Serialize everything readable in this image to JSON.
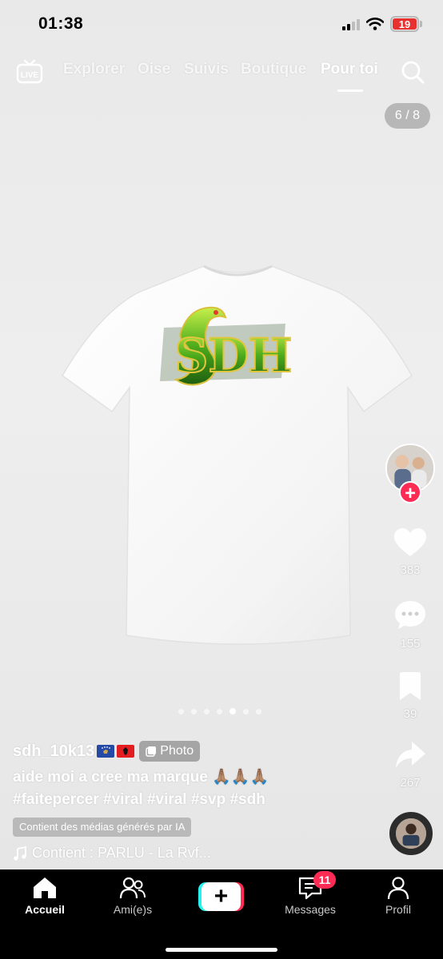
{
  "status_bar": {
    "time": "01:38",
    "battery": "19"
  },
  "top_nav": {
    "live_label": "LIVE",
    "tabs": [
      {
        "label": "Explorer",
        "active": false
      },
      {
        "label": "Oise",
        "active": false
      },
      {
        "label": "Suivis",
        "active": false
      },
      {
        "label": "Boutique",
        "active": false
      },
      {
        "label": "Pour toi",
        "active": true
      }
    ]
  },
  "post": {
    "page_counter": "6 / 8",
    "logo_text": "SDH",
    "carousel": {
      "total": 7,
      "active_index": 4
    },
    "username": "sdh_10k13",
    "flags": [
      "kosovo-flag",
      "albania-flag"
    ],
    "photo_badge": "Photo",
    "description": "aide moi a cree ma marque 🙏🏽🙏🏽🙏🏽",
    "hashtags": "#faitepercer #viral #viral #svp #sdh",
    "ai_label": "Contient des médias générés par IA",
    "music": "Contient : PARLU - La Rvf..."
  },
  "actions": {
    "likes": "383",
    "comments": "155",
    "saves": "39",
    "shares": "267"
  },
  "bottom_nav": {
    "home": "Accueil",
    "friends": "Ami(e)s",
    "create": "+",
    "messages": "Messages",
    "messages_badge": "11",
    "profile": "Profil"
  },
  "colors": {
    "accent": "#fe2c55",
    "cyan": "#25f4ee"
  }
}
